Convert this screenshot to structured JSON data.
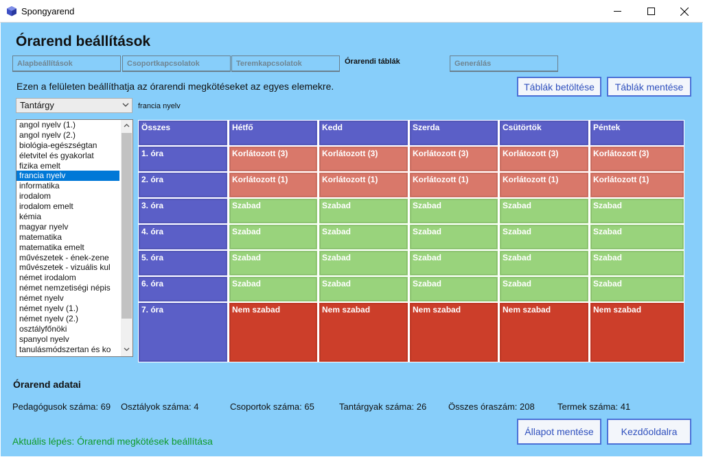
{
  "window": {
    "title": "Spongyarend"
  },
  "page": {
    "title": "Órarend beállítások"
  },
  "tabs": [
    {
      "label": "Alapbeállítások"
    },
    {
      "label": "Csoportkapcsolatok"
    },
    {
      "label": "Teremkapcsolatok"
    },
    {
      "label": "Órarendi táblák"
    },
    {
      "label": "Generálás"
    }
  ],
  "description": "Ezen a felületen beállíthatja az órarendi megkötéseket az egyes elemekre.",
  "buttons": {
    "load_tables": "Táblák betöltése",
    "save_tables": "Táblák mentése",
    "save_state": "Állapot mentése",
    "home": "Kezdőoldalra"
  },
  "filter": {
    "type_value": "Tantárgy",
    "selected_label": "francia nyelv"
  },
  "list": {
    "items": [
      "angol nyelv (1.)",
      "angol nyelv (2.)",
      "biológia-egészségtan",
      "életvitel és gyakorlat",
      "fizika emelt",
      "francia nyelv",
      "informatika",
      "irodalom",
      "irodalom emelt",
      "kémia",
      "magyar nyelv",
      "matematika",
      "matematika emelt",
      "művészetek - ének-zene",
      "művészetek - vizuális kul",
      "német irodalom",
      "német nemzetiségi népis",
      "német nyelv",
      "német nyelv (1.)",
      "német nyelv (2.)",
      "osztályfőnöki",
      "spanyol nyelv",
      "tanulásmódszertan és ko"
    ],
    "selected_index": 5
  },
  "timetable": {
    "corner": "Összes",
    "days": [
      "Hétfő",
      "Kedd",
      "Szerda",
      "Csütörtök",
      "Péntek"
    ],
    "rows": [
      {
        "label": "1. óra",
        "status": "korl",
        "cells": [
          "Korlátozott (3)",
          "Korlátozott (3)",
          "Korlátozott (3)",
          "Korlátozott (3)",
          "Korlátozott (3)"
        ]
      },
      {
        "label": "2. óra",
        "status": "korl",
        "cells": [
          "Korlátozott (1)",
          "Korlátozott (1)",
          "Korlátozott (1)",
          "Korlátozott (1)",
          "Korlátozott (1)"
        ]
      },
      {
        "label": "3. óra",
        "status": "szab",
        "cells": [
          "Szabad",
          "Szabad",
          "Szabad",
          "Szabad",
          "Szabad"
        ]
      },
      {
        "label": "4. óra",
        "status": "szab",
        "cells": [
          "Szabad",
          "Szabad",
          "Szabad",
          "Szabad",
          "Szabad"
        ]
      },
      {
        "label": "5. óra",
        "status": "szab",
        "cells": [
          "Szabad",
          "Szabad",
          "Szabad",
          "Szabad",
          "Szabad"
        ]
      },
      {
        "label": "6. óra",
        "status": "szab",
        "cells": [
          "Szabad",
          "Szabad",
          "Szabad",
          "Szabad",
          "Szabad"
        ]
      },
      {
        "label": "7. óra",
        "status": "nem",
        "cells": [
          "Nem szabad",
          "Nem szabad",
          "Nem szabad",
          "Nem szabad",
          "Nem szabad"
        ]
      }
    ]
  },
  "info": {
    "title": "Órarend adatai",
    "stats": [
      "Pedagógusok száma: 69",
      "Osztályok száma: 4",
      "Csoportok száma: 65",
      "Tantárgyak száma: 26",
      "Összes óraszám: 208",
      "Termek száma: 41"
    ]
  },
  "status_text": "Aktuális lépés: Órarendi megkötések beállítása",
  "colors": {
    "background": "#87cefa",
    "header_cell": "#5b5fc7",
    "restricted": "#d9786a",
    "free": "#99d37c",
    "not_free": "#cc3e2a",
    "button_border": "#4a6fd6",
    "status_text": "#0f9a2a"
  }
}
